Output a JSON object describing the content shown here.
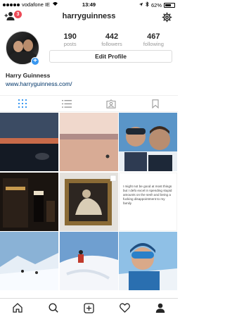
{
  "status_bar": {
    "carrier": "vodafone IE",
    "time": "13:49",
    "battery": "62%"
  },
  "header": {
    "username": "harryguinness",
    "notification_count": "3"
  },
  "profile": {
    "posts_count": "190",
    "posts_label": "posts",
    "followers_count": "442",
    "followers_label": "followers",
    "following_count": "467",
    "following_label": "following",
    "edit_profile_label": "Edit Profile",
    "name": "Harry Guinness",
    "website": "www.harryguinness.com/"
  },
  "tabs": [
    "grid-icon",
    "list-icon",
    "tagged-icon",
    "saved-icon"
  ],
  "grid": {
    "quote_text": "I might not be good at most things but I defo excel in spending stupid amounts on the sesh and being a fucking disappointment to my family"
  },
  "bottom_nav": [
    "home-icon",
    "search-icon",
    "add-post-icon",
    "heart-icon",
    "profile-icon"
  ],
  "colors": {
    "accent": "#3897f0",
    "badge": "#ed4956",
    "link": "#003569",
    "active_tab": "#3897f0"
  }
}
